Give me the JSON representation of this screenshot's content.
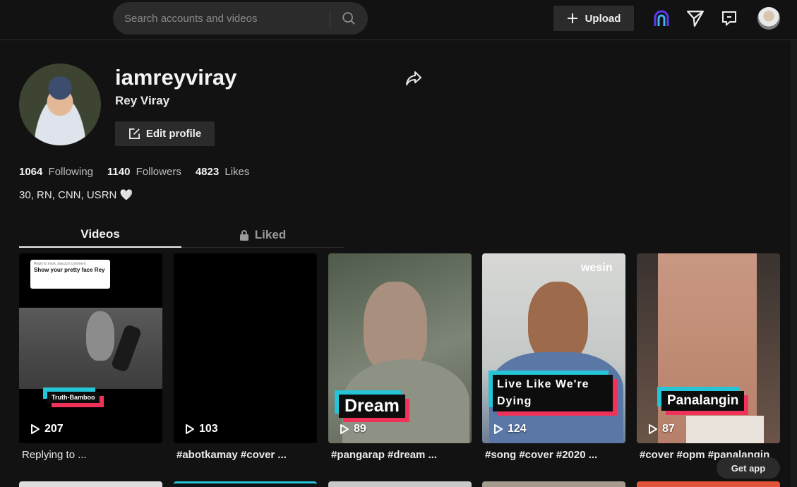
{
  "header": {
    "search_placeholder": "Search accounts and videos",
    "upload_label": "Upload",
    "icons": [
      "search-icon",
      "plus-icon",
      "live-icon",
      "inbox-send-icon",
      "messages-icon",
      "avatar"
    ]
  },
  "profile": {
    "username": "iamreyviray",
    "display_name": "Rey Viray",
    "edit_label": "Edit profile",
    "following_count": "1064",
    "following_label": "Following",
    "followers_count": "1140",
    "followers_label": "Followers",
    "likes_count": "4823",
    "likes_label": "Likes",
    "bio": "30, RN, CNN, USRN 🤍"
  },
  "tabs": {
    "videos": "Videos",
    "liked": "Liked"
  },
  "videos": [
    {
      "views": "207",
      "caption": "Replying to ...",
      "overlay": "Truth-Bamboo",
      "reply_to": "Reply to mark_diauzz's comment",
      "reply_text": "Show your pretty face Rey"
    },
    {
      "views": "103",
      "caption": "#abotkamay #cover ...",
      "overlay": ""
    },
    {
      "views": "89",
      "caption": "#pangarap #dream ...",
      "overlay": "Dream"
    },
    {
      "views": "124",
      "caption": "#song #cover #2020 ...",
      "overlay": "Live Like We're Dying",
      "brand": "wesin"
    },
    {
      "views": "87",
      "caption": "#cover #opm #panalangin",
      "overlay": "Panalangin"
    }
  ],
  "get_app_label": "Get app",
  "colors": {
    "bg": "#121212",
    "surface": "#2b2b2b",
    "cyan": "#25c4d6",
    "pink": "#f0325a"
  }
}
